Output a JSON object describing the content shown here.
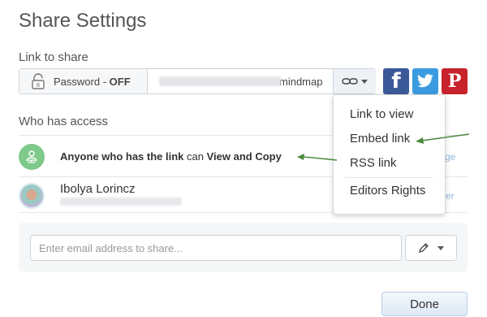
{
  "dialog": {
    "title": "Share Settings"
  },
  "link_section": {
    "label": "Link to share",
    "password_prefix": "Password - ",
    "password_state": "OFF",
    "url_visible_tail": "mindmap"
  },
  "social": {
    "facebook": "f",
    "pinterest": "P"
  },
  "access_section": {
    "label": "Who has access",
    "anyone": {
      "pre": "Anyone who has the link",
      "mid": " can ",
      "post": "View and Copy",
      "action": "ge"
    },
    "user": {
      "name": "Ibolya Lorincz",
      "role": "er"
    }
  },
  "menu": {
    "items": [
      "Link to view",
      "Embed link",
      "RSS link",
      "Editors Rights"
    ]
  },
  "invite": {
    "placeholder": "Enter email address to share..."
  },
  "footer": {
    "done_label": "Done"
  },
  "colors": {
    "arrow": "#4a8a3c",
    "accent": "#3b9be0",
    "access_icon_bg": "#7fc98a"
  }
}
